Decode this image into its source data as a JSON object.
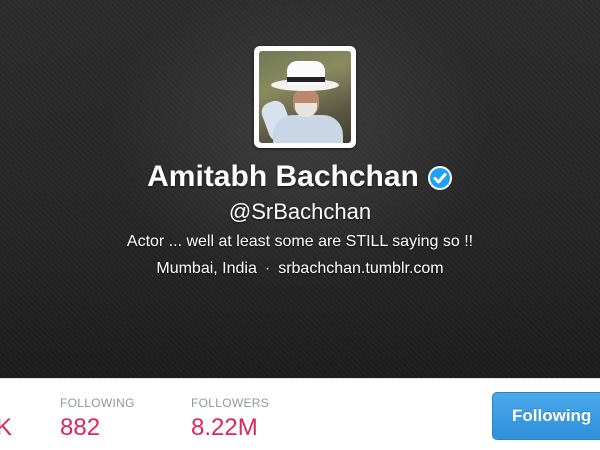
{
  "profile": {
    "name": "Amitabh Bachchan",
    "verified_icon": "verified-badge-icon",
    "handle": "@SrBachchan",
    "bio": "Actor ... well at least some are STILL saying so !!",
    "location": "Mumbai, India",
    "separator": "·",
    "website": "srbachchan.tumblr.com"
  },
  "stats": {
    "cut_off_value": "K",
    "following_label": "FOLLOWING",
    "following_value": "882",
    "followers_label": "FOLLOWERS",
    "followers_value": "8.22M"
  },
  "actions": {
    "follow_button_label": "Following"
  },
  "colors": {
    "accent_blue": "#2f8fd8",
    "stat_value_red": "#e0245e",
    "stat_label_gray": "#8899a6",
    "verified_blue": "#1da1f2",
    "header_bg": "#252525"
  }
}
